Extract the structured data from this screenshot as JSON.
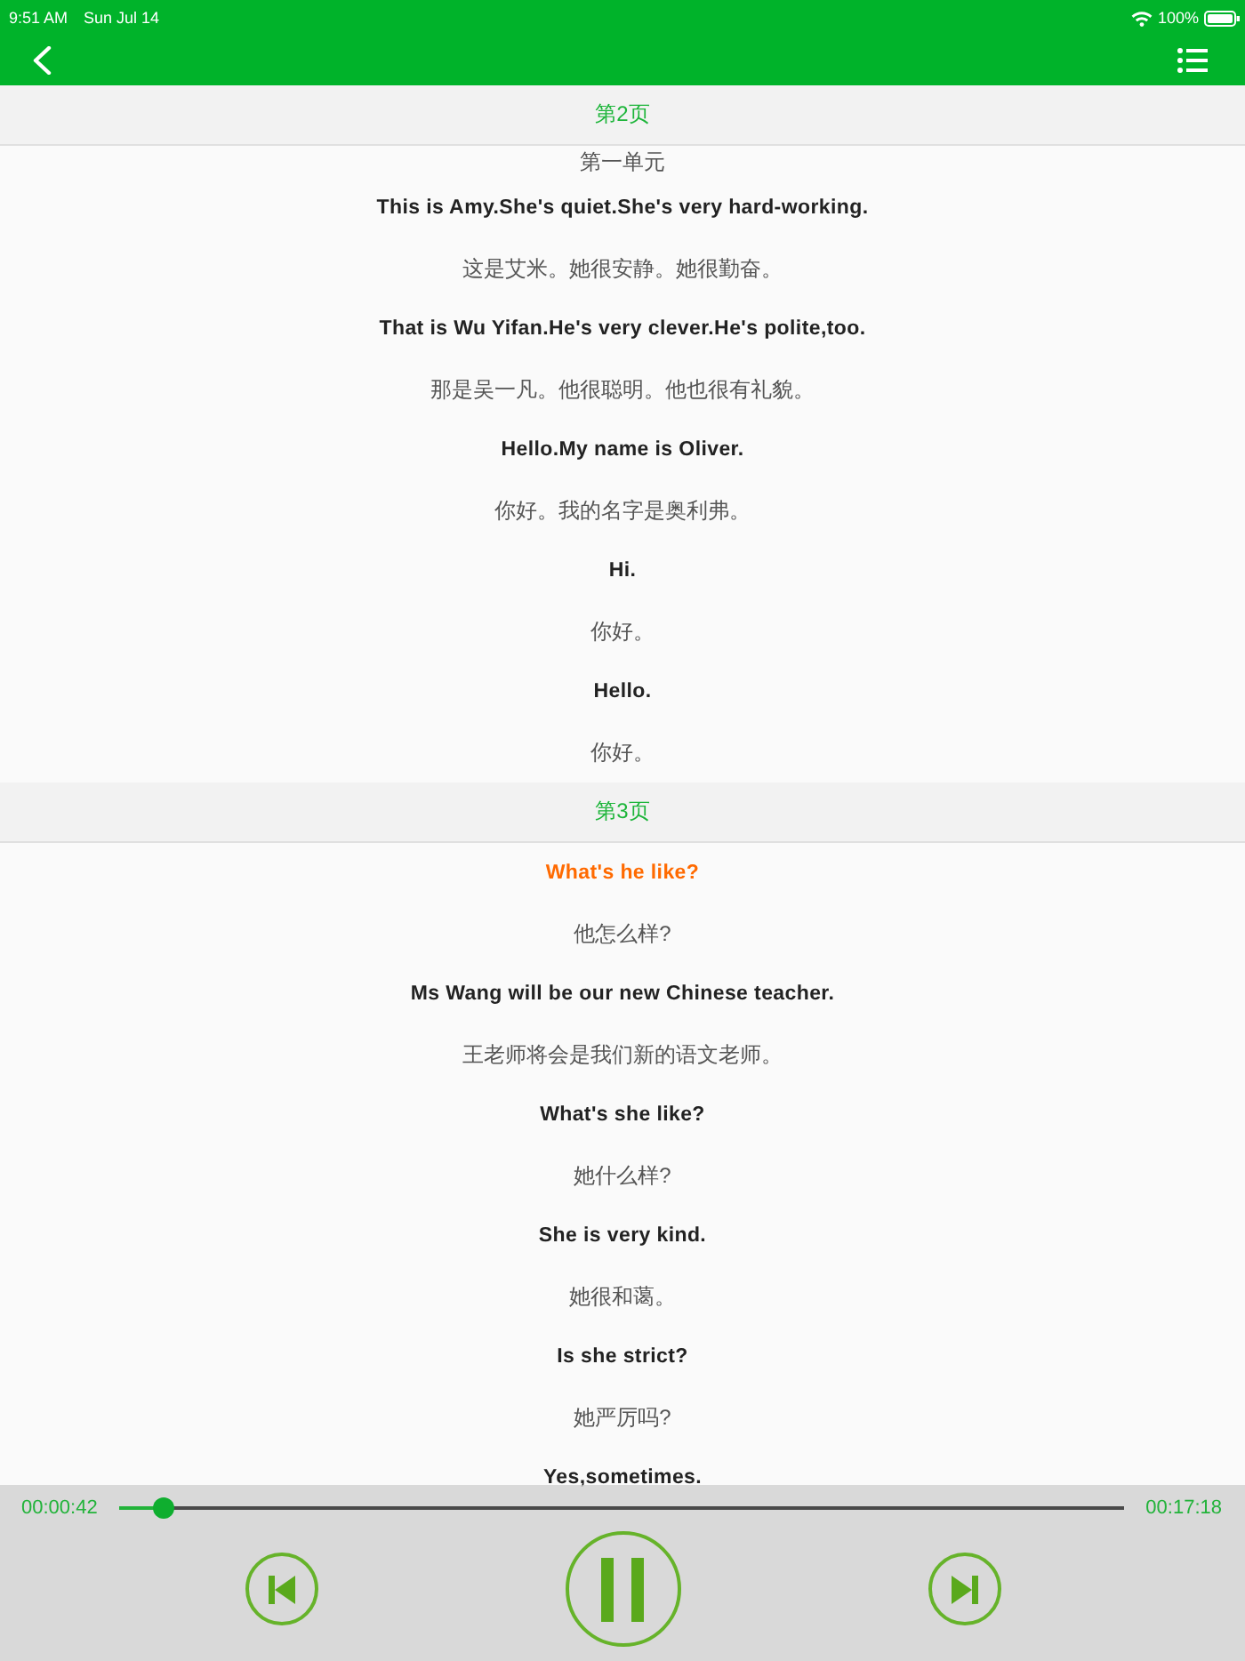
{
  "status_bar": {
    "time": "9:51 AM",
    "date": "Sun Jul 14",
    "battery": "100%"
  },
  "sections": [
    {
      "header": "第2页",
      "sentences": [
        {
          "chinese": "第一单元",
          "selected": false
        },
        {
          "english": "This is Amy.She's quiet.She's very hard-working.",
          "chinese": "这是艾米。她很安静。她很勤奋。",
          "selected": false
        },
        {
          "english": "That is Wu Yifan.He's very clever.He's polite,too.",
          "chinese": "那是吴一凡。他很聪明。他也很有礼貌。",
          "selected": false
        },
        {
          "english": "Hello.My name is Oliver.",
          "chinese": "你好。我的名字是奥利弗。",
          "selected": false
        },
        {
          "english": "Hi.",
          "chinese": "你好。",
          "selected": false
        },
        {
          "english": "Hello.",
          "chinese": "你好。",
          "selected": false
        }
      ]
    },
    {
      "header": "第3页",
      "sentences": [
        {
          "english": "What's he like?",
          "chinese": "他怎么样?",
          "selected": true
        },
        {
          "english": "Ms Wang will be our new Chinese teacher.",
          "chinese": "王老师将会是我们新的语文老师。",
          "selected": false
        },
        {
          "english": "What's she like?",
          "chinese": "她什么样?",
          "selected": false
        },
        {
          "english": "She is very kind.",
          "chinese": "她很和蔼。",
          "selected": false
        },
        {
          "english": "Is she strict?",
          "chinese": "她严厉吗?",
          "selected": false
        },
        {
          "english": "Yes,sometimes.",
          "selected": false
        }
      ]
    }
  ],
  "player": {
    "elapsed": "00:00:42",
    "duration": "00:17:18",
    "level": 0.045,
    "playing": true
  }
}
